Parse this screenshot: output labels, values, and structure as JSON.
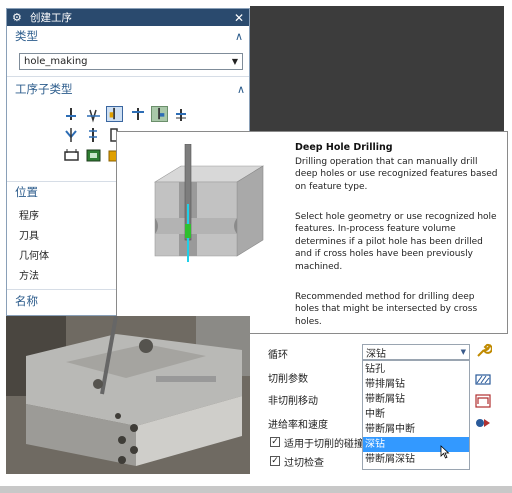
{
  "dialog": {
    "title": "创建工序",
    "type_section": "类型",
    "type_value": "hole_making",
    "subtype_section": "工序子类型",
    "location_section": "位置",
    "location_items": [
      "程序",
      "刀具",
      "几何体",
      "方法"
    ],
    "name_section": "名称"
  },
  "tooltip": {
    "title": "Deep Hole Drilling",
    "para1_lines": [
      "Drilling operation that can manually drill",
      "deep holes or use recognized features based",
      "on feature type."
    ],
    "para2_lines": [
      "Select hole geometry or use recognized hole",
      "features. In-process feature volume",
      "determines if a pilot hole has been drilled",
      "and if cross holes have been previously",
      "machined."
    ],
    "para3_lines": [
      "Recommended method for drilling deep",
      "holes that might be intersected by cross",
      "holes."
    ]
  },
  "params": {
    "cycle_label": "循环",
    "cycle_value": "深钻",
    "rows": [
      "切削参数",
      "非切削移动",
      "进给率和速度"
    ],
    "checkbox1": "适用于切削的碰撞",
    "checkbox2": "过切检查",
    "options": [
      "钻孔",
      "带排屑钻",
      "带断屑钻",
      "中断",
      "带断屑中断",
      "深钻",
      "带断屑深钻"
    ],
    "selected_option": "深钻"
  },
  "colors": {
    "titlebar": "#2a4a6e",
    "section_text": "#2c5c8c",
    "highlight": "#3399ff",
    "viewport": "#3c3c3c"
  }
}
